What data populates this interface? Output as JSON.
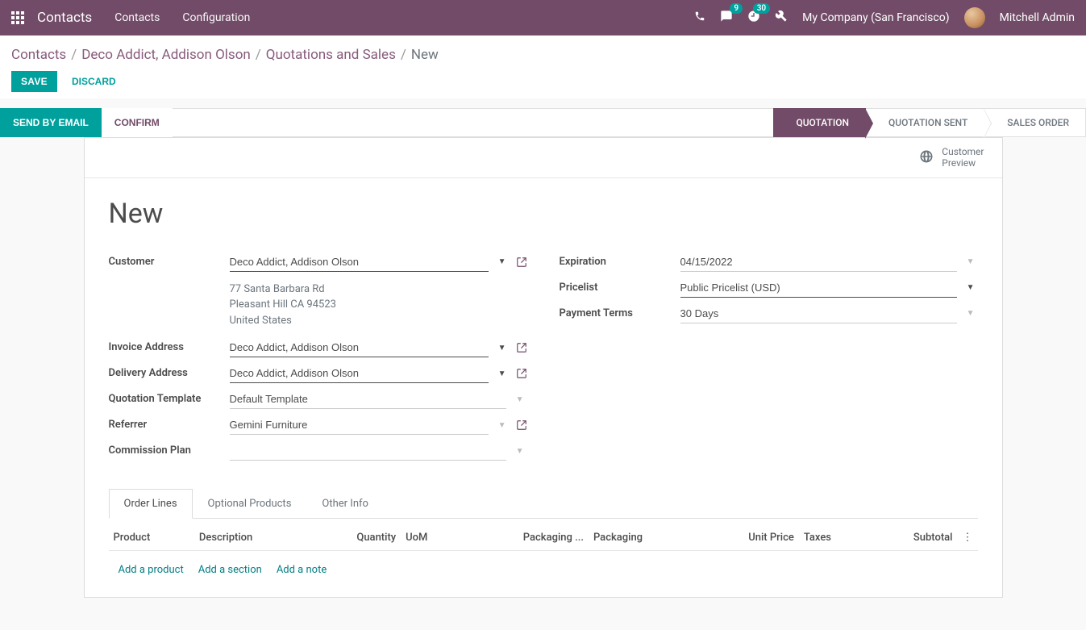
{
  "topnav": {
    "module": "Contacts",
    "menu": [
      "Contacts",
      "Configuration"
    ],
    "msg_badge": "9",
    "activity_badge": "30",
    "company": "My Company (San Francisco)",
    "user": "Mitchell Admin"
  },
  "breadcrumb": {
    "parts": [
      "Contacts",
      "Deco Addict, Addison Olson",
      "Quotations and Sales"
    ],
    "current": "New"
  },
  "actions": {
    "save": "SAVE",
    "discard": "DISCARD"
  },
  "statusbar": {
    "send": "SEND BY EMAIL",
    "confirm": "CONFIRM",
    "stages": [
      "QUOTATION",
      "QUOTATION SENT",
      "SALES ORDER"
    ]
  },
  "preview": {
    "line1": "Customer",
    "line2": "Preview"
  },
  "title": "New",
  "form": {
    "customer_label": "Customer",
    "customer": "Deco Addict, Addison Olson",
    "address1": "77 Santa Barbara Rd",
    "address2": "Pleasant Hill CA 94523",
    "address3": "United States",
    "invoice_label": "Invoice Address",
    "invoice": "Deco Addict, Addison Olson",
    "delivery_label": "Delivery Address",
    "delivery": "Deco Addict, Addison Olson",
    "template_label": "Quotation Template",
    "template": "Default Template",
    "referrer_label": "Referrer",
    "referrer": "Gemini Furniture",
    "commission_label": "Commission Plan",
    "commission": "",
    "expiration_label": "Expiration",
    "expiration": "04/15/2022",
    "pricelist_label": "Pricelist",
    "pricelist": "Public Pricelist (USD)",
    "terms_label": "Payment Terms",
    "terms": "30 Days"
  },
  "tabs": [
    "Order Lines",
    "Optional Products",
    "Other Info"
  ],
  "columns": {
    "product": "Product",
    "description": "Description",
    "quantity": "Quantity",
    "uom": "UoM",
    "pkg_qty": "Packaging ...",
    "packaging": "Packaging",
    "unit_price": "Unit Price",
    "taxes": "Taxes",
    "subtotal": "Subtotal"
  },
  "add": {
    "product": "Add a product",
    "section": "Add a section",
    "note": "Add a note"
  }
}
